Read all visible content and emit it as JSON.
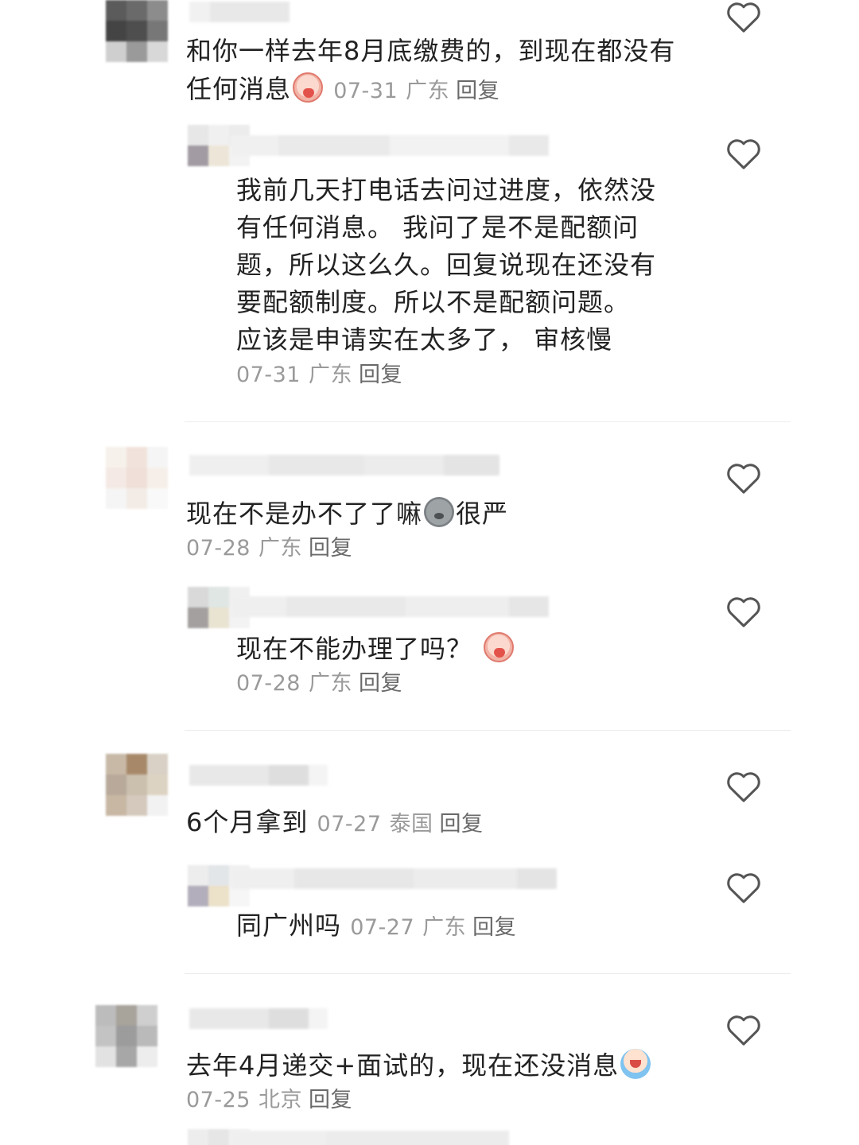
{
  "comments": [
    {
      "text": "和你一样去年8月底缴费的，到现在都没有任何消息",
      "emoji": "crying-face-emoji",
      "date": "07-31",
      "location": "广东",
      "reply_label": "回复",
      "reply": {
        "text_lines": [
          "我前几天打电话去问过进度，依然没",
          "有任何消息。 我问了是不是配额问",
          "题，所以这么久。回复说现在还没有",
          "要配额制度。所以不是配额问题。",
          "应该是申请实在太多了， 审核慢"
        ],
        "date": "07-31",
        "location": "广东",
        "reply_label": "回复"
      }
    },
    {
      "text_before": "现在不是办不了了嘛",
      "emoji": "gray-sad-face-emoji",
      "text_after": "很严",
      "date": "07-28",
      "location": "广东",
      "reply_label": "回复",
      "reply": {
        "text": "现在不能办理了吗？",
        "emoji": "crying-face-emoji",
        "date": "07-28",
        "location": "广东",
        "reply_label": "回复"
      }
    },
    {
      "text": "6个月拿到",
      "date": "07-27",
      "location": "泰国",
      "reply_label": "回复",
      "reply": {
        "text": "同广州吗",
        "date": "07-27",
        "location": "广东",
        "reply_label": "回复"
      }
    },
    {
      "text": "去年4月递交+面试的，现在还没消息",
      "emoji": "tearful-face-emoji",
      "date": "07-25",
      "location": "北京",
      "reply_label": "回复"
    }
  ],
  "icons": {
    "like": "heart-outline-icon"
  },
  "colors": {
    "text": "#222222",
    "meta": "#9a9a9a",
    "reply": "#6a6a6a",
    "divider": "#ececec",
    "heart_stroke": "#555555"
  }
}
